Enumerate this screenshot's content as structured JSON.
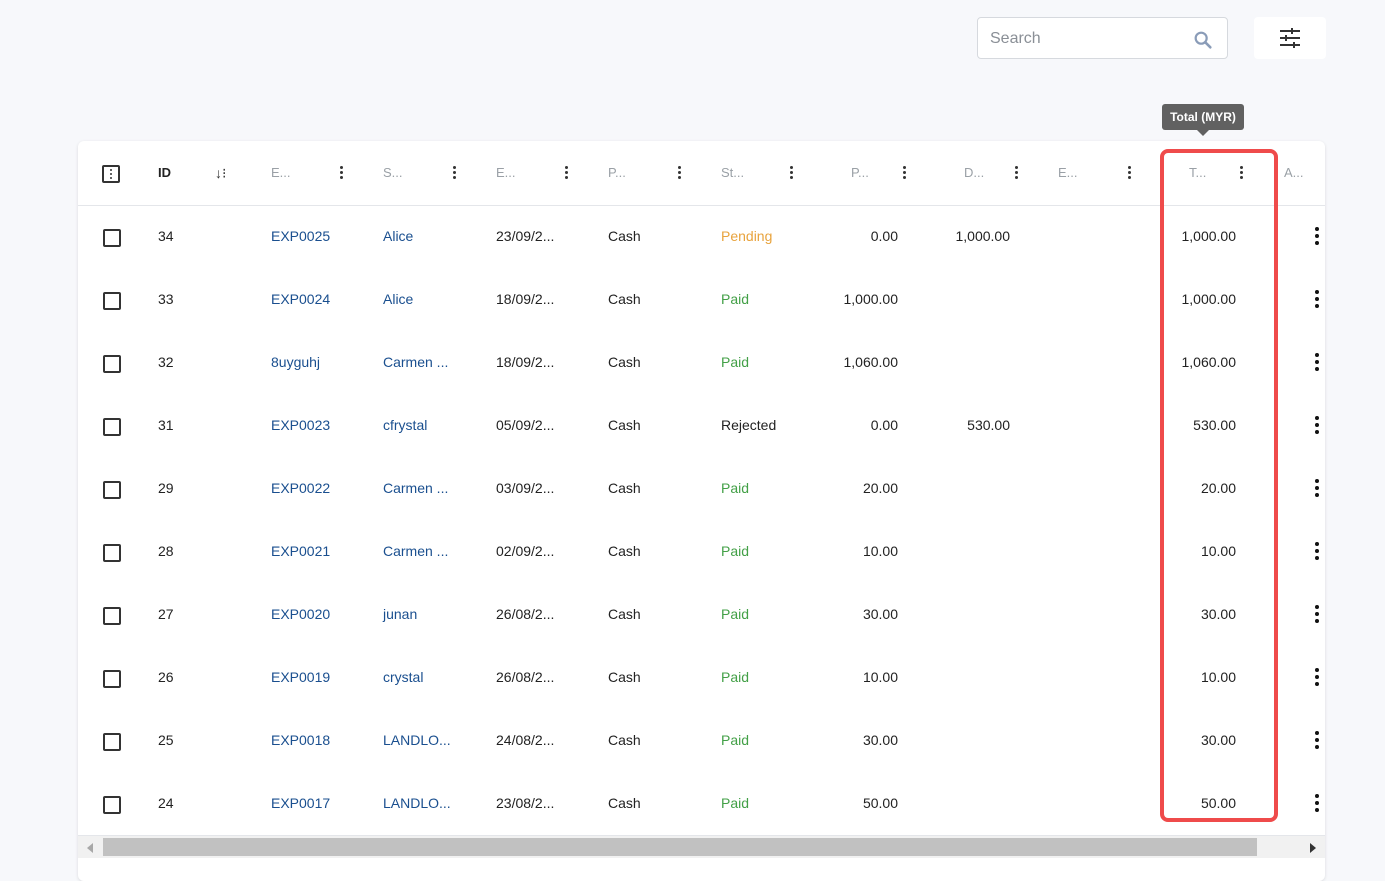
{
  "search": {
    "placeholder": "Search",
    "value": ""
  },
  "icons": {
    "search": "search-icon",
    "filter": "tune-sliders-icon"
  },
  "tooltip": {
    "text": "Total (MYR)"
  },
  "columns": {
    "id": "ID",
    "e1": "E...",
    "s": "S...",
    "e2": "E...",
    "p": "P...",
    "st": "St...",
    "p2": "P...",
    "d": "D...",
    "e3": "E...",
    "t": "T...",
    "a": "A..."
  },
  "colors": {
    "highlight": "#ef4b4b",
    "link": "#1a4f8f",
    "paid": "#43a047",
    "pending": "#e8a33d"
  },
  "rows": [
    {
      "id": "34",
      "exp": "EXP0025",
      "submitter": "Alice",
      "date": "23/09/2...",
      "payment": "Cash",
      "status": "Pending",
      "status_class": "pending",
      "paid": "0.00",
      "due": "1,000.00",
      "total": "1,000.00"
    },
    {
      "id": "33",
      "exp": "EXP0024",
      "submitter": "Alice",
      "date": "18/09/2...",
      "payment": "Cash",
      "status": "Paid",
      "status_class": "paid",
      "paid": "1,000.00",
      "due": "",
      "total": "1,000.00"
    },
    {
      "id": "32",
      "exp": "8uyguhj",
      "submitter": "Carmen ...",
      "date": "18/09/2...",
      "payment": "Cash",
      "status": "Paid",
      "status_class": "paid",
      "paid": "1,060.00",
      "due": "",
      "total": "1,060.00"
    },
    {
      "id": "31",
      "exp": "EXP0023",
      "submitter": "cfrystal",
      "date": "05/09/2...",
      "payment": "Cash",
      "status": "Rejected",
      "status_class": "rejected",
      "paid": "0.00",
      "due": "530.00",
      "total": "530.00"
    },
    {
      "id": "29",
      "exp": "EXP0022",
      "submitter": "Carmen ...",
      "date": "03/09/2...",
      "payment": "Cash",
      "status": "Paid",
      "status_class": "paid",
      "paid": "20.00",
      "due": "",
      "total": "20.00"
    },
    {
      "id": "28",
      "exp": "EXP0021",
      "submitter": "Carmen ...",
      "date": "02/09/2...",
      "payment": "Cash",
      "status": "Paid",
      "status_class": "paid",
      "paid": "10.00",
      "due": "",
      "total": "10.00"
    },
    {
      "id": "27",
      "exp": "EXP0020",
      "submitter": "junan",
      "date": "26/08/2...",
      "payment": "Cash",
      "status": "Paid",
      "status_class": "paid",
      "paid": "30.00",
      "due": "",
      "total": "30.00"
    },
    {
      "id": "26",
      "exp": "EXP0019",
      "submitter": "crystal",
      "date": "26/08/2...",
      "payment": "Cash",
      "status": "Paid",
      "status_class": "paid",
      "paid": "10.00",
      "due": "",
      "total": "10.00"
    },
    {
      "id": "25",
      "exp": "EXP0018",
      "submitter": "LANDLO...",
      "date": "24/08/2...",
      "payment": "Cash",
      "status": "Paid",
      "status_class": "paid",
      "paid": "30.00",
      "due": "",
      "total": "30.00"
    },
    {
      "id": "24",
      "exp": "EXP0017",
      "submitter": "LANDLO...",
      "date": "23/08/2...",
      "payment": "Cash",
      "status": "Paid",
      "status_class": "paid",
      "paid": "50.00",
      "due": "",
      "total": "50.00"
    }
  ]
}
